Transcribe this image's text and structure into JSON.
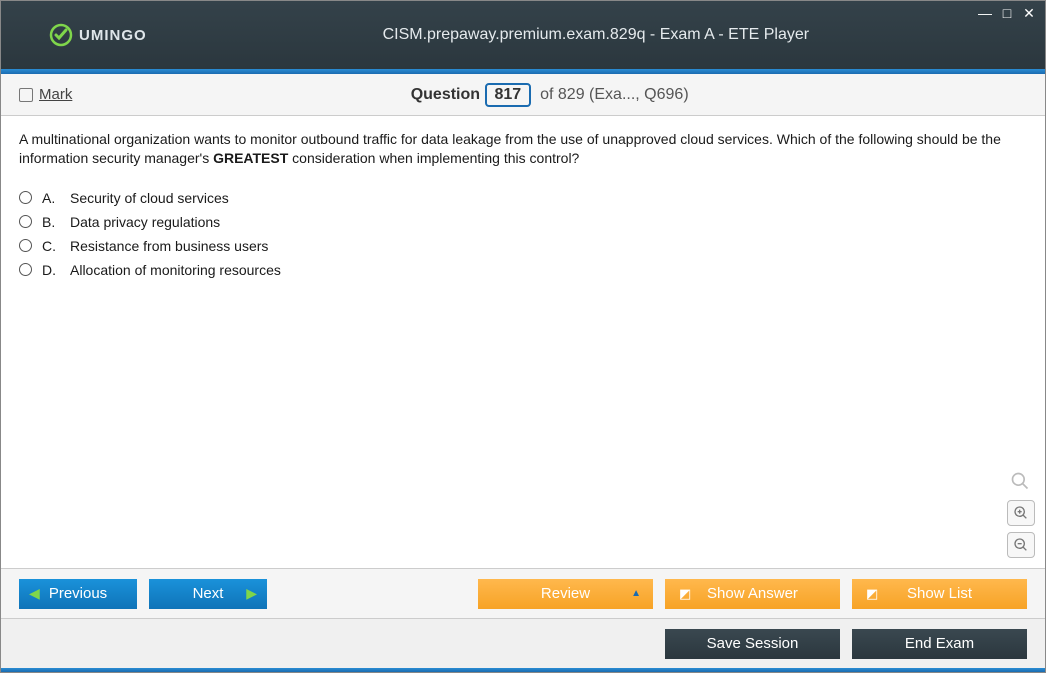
{
  "window": {
    "title": "CISM.prepaway.premium.exam.829q - Exam A - ETE Player",
    "logo_text": "UMINGO"
  },
  "header": {
    "mark_label": "Mark",
    "question_label": "Question",
    "current_number": "817",
    "of_label": "of",
    "total": "829",
    "suffix": "(Exa..., Q696)"
  },
  "question": {
    "text_prefix": "A multinational organization wants to monitor outbound traffic for data leakage from the use of unapproved cloud services. Which of the following should be the information security manager's ",
    "text_bold": "GREATEST",
    "text_suffix": " consideration when implementing this control?",
    "options": [
      {
        "letter": "A.",
        "text": "Security of cloud services"
      },
      {
        "letter": "B.",
        "text": "Data privacy regulations"
      },
      {
        "letter": "C.",
        "text": "Resistance from business users"
      },
      {
        "letter": "D.",
        "text": "Allocation of monitoring resources"
      }
    ]
  },
  "footer": {
    "previous": "Previous",
    "next": "Next",
    "review": "Review",
    "show_answer": "Show Answer",
    "show_list": "Show List",
    "save_session": "Save Session",
    "end_exam": "End Exam"
  }
}
